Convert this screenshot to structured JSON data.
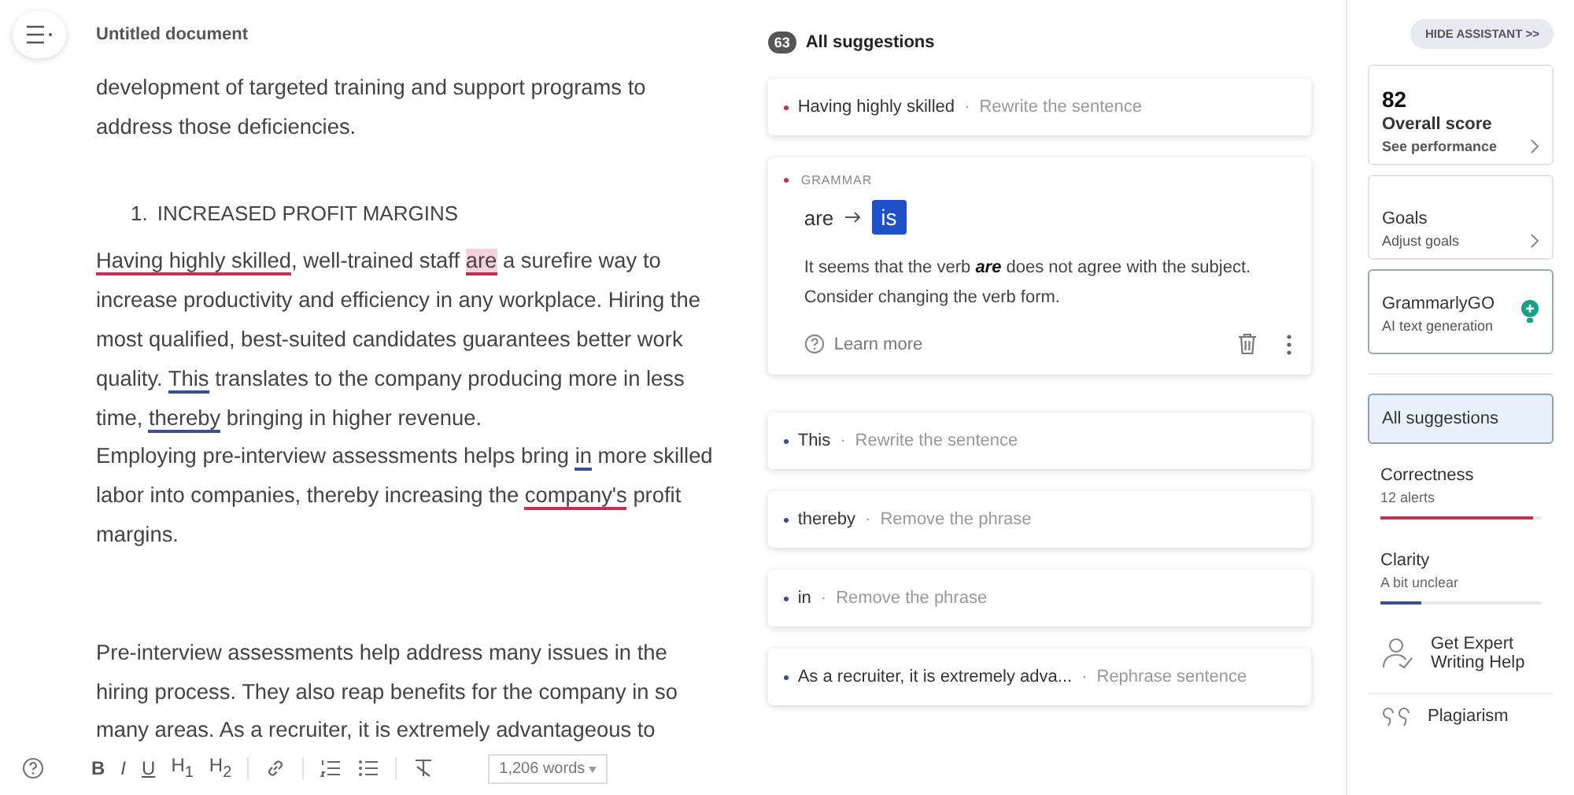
{
  "document": {
    "title": "Untitled document",
    "blocks": [
      {
        "kind": "paragraph",
        "segments": [
          {
            "text": "development of targeted training and support programs to address those deficiencies."
          }
        ]
      },
      {
        "kind": "gap"
      },
      {
        "kind": "list_item",
        "number": "1.",
        "segments": [
          {
            "text": "INCREASED PROFIT MARGINS"
          }
        ]
      },
      {
        "kind": "paragraph",
        "segments": [
          {
            "text": "Having highly skilled",
            "color": "#c0324f",
            "active": false
          },
          {
            "text": ", well-trained staff "
          },
          {
            "text": "are",
            "color": "#c0324f",
            "active": true
          },
          {
            "text": " a surefire way to increase productivity and efficiency in any workplace. Hiring the most qualified, best-suited candidates guarantees better work quality. "
          },
          {
            "text": "This",
            "color": "#3a4f91",
            "active": false
          },
          {
            "text": " translates to the company producing more in less time, "
          },
          {
            "text": "thereby",
            "color": "#3a4f91",
            "active": false
          },
          {
            "text": " bringing in higher revenue."
          }
        ]
      },
      {
        "kind": "paragraph",
        "segments": [
          {
            "text": "Employing pre-interview assessments helps bring "
          },
          {
            "text": "in",
            "color": "#3a4f91",
            "active": false
          },
          {
            "text": " more skilled labor into companies, thereby increasing the "
          },
          {
            "text": "company's",
            "color": "#c0324f",
            "active": false
          },
          {
            "text": " profit margins."
          }
        ]
      },
      {
        "kind": "gap"
      },
      {
        "kind": "paragraph",
        "segments": [
          {
            "text": "Pre-interview assessments help address many issues in the hiring process. They also reap benefits for the company in so many areas. As a recruiter, it is extremely advantageous to"
          }
        ]
      }
    ]
  },
  "toolbar": {
    "buttons": [
      "B",
      "I",
      "U",
      "H$_{1}$",
      "H$_{2}$"
    ],
    "word_count": "1,206 words"
  },
  "suggestions": {
    "count": "63",
    "title": "All suggestions",
    "items": [
      {
        "kind": "collapsed",
        "color": "#c0324f",
        "phrase": "Having highly skilled",
        "separator": "·",
        "action": "Rewrite the sentence"
      },
      {
        "kind": "expanded",
        "color": "#c0324f",
        "category": "GRAMMAR",
        "original": "are",
        "replacement": "is",
        "explanation": "It seems that the verb **are** does not agree with the subject. Consider changing the verb form.",
        "link": "Learn more"
      },
      {
        "kind": "collapsed",
        "color": "#3a4f91",
        "phrase": "This",
        "separator": "·",
        "action": "Rewrite the sentence"
      },
      {
        "kind": "collapsed",
        "color": "#3a4f91",
        "phrase": "thereby",
        "separator": "·",
        "action": "Remove the phrase"
      },
      {
        "kind": "collapsed",
        "color": "#3a4f91",
        "phrase": "in",
        "separator": "·",
        "action": "Remove the phrase"
      },
      {
        "kind": "collapsed",
        "color": "#3a4f91",
        "phrase": "As a recruiter, it is extremely adva...",
        "separator": "·",
        "action": "Rephrase sentence"
      }
    ]
  },
  "assistant": {
    "hide_button": "HIDE ASSISTANT >>",
    "cards": [
      {
        "kind": "score",
        "score": "82",
        "title": "Overall score",
        "subtitle": "See performance"
      },
      {
        "kind": "link",
        "title": "Goals",
        "subtitle": "Adjust goals"
      },
      {
        "kind": "go",
        "title": "GrammarlyGO",
        "subtitle": "AI text generation"
      }
    ],
    "categories": [
      {
        "kind": "all",
        "label": "All suggestions",
        "selected": true
      },
      {
        "kind": "meter",
        "label": "Correctness",
        "detail": "12 alerts",
        "level": 0.95,
        "color": "#c0324f",
        "selected": false
      },
      {
        "kind": "meter",
        "label": "Clarity",
        "detail": "A bit unclear",
        "level": 0.25,
        "color": "#3a4f91",
        "selected": false
      }
    ],
    "tools": [
      {
        "kind": "expert",
        "label": "Get Expert Writing Help"
      },
      {
        "kind": "plagiarism",
        "label": "Plagiarism"
      }
    ]
  }
}
